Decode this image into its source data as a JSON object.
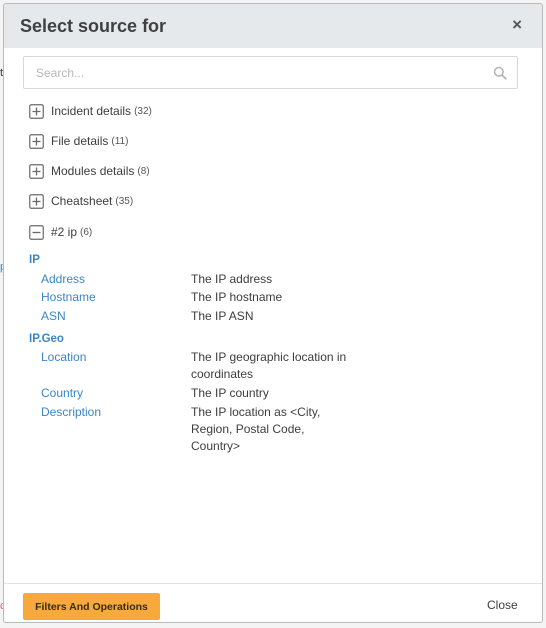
{
  "background": {
    "glyphs": [
      "t",
      "p",
      "c"
    ]
  },
  "dialog": {
    "title": "Select source for",
    "close_icon": "close-icon"
  },
  "search": {
    "placeholder": "Search...",
    "value": "",
    "icon": "search-icon"
  },
  "sources": [
    {
      "label": "Incident details",
      "count": "(32)",
      "state": "collapsed"
    },
    {
      "label": "File details",
      "count": "(11)",
      "state": "collapsed"
    },
    {
      "label": "Modules details",
      "count": "(8)",
      "state": "collapsed"
    },
    {
      "label": "Cheatsheet",
      "count": "(35)",
      "state": "collapsed"
    },
    {
      "label": "#2 ip",
      "count": "(6)",
      "state": "expanded"
    }
  ],
  "expanded_source": {
    "groups": [
      {
        "name": "IP",
        "fields": [
          {
            "key": "Address",
            "description": "The IP address"
          },
          {
            "key": "Hostname",
            "description": "The IP hostname"
          },
          {
            "key": "ASN",
            "description": "The IP ASN"
          }
        ]
      },
      {
        "name": "IP.Geo",
        "fields": [
          {
            "key": "Location",
            "description": "The IP geographic location in coordinates"
          },
          {
            "key": "Country",
            "description": "The IP country"
          },
          {
            "key": "Description",
            "description": "The IP location as <City, Region, Postal Code, Country>"
          }
        ]
      }
    ]
  },
  "footer": {
    "primary_button": "Filters And Operations",
    "close_button": "Close"
  },
  "colors": {
    "accent_orange": "#f7a93b",
    "link_blue": "#3b86c8",
    "header_bg": "#e6e9ec"
  }
}
